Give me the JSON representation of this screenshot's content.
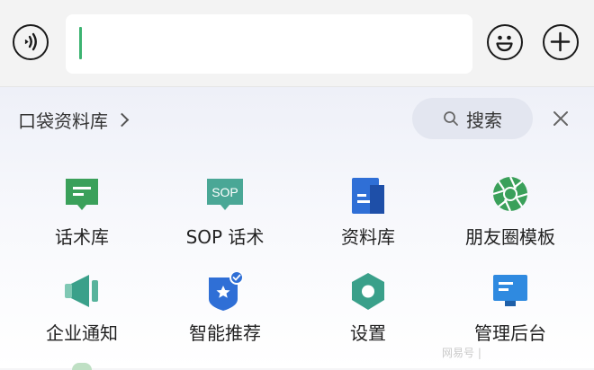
{
  "input_bar": {
    "text_value": ""
  },
  "panel": {
    "library_title": "口袋资料库",
    "search_label": "搜索"
  },
  "grid": [
    {
      "label": "话术库",
      "icon": "chat-bubble-green-icon"
    },
    {
      "label": "SOP 话术",
      "icon": "sop-bubble-icon",
      "badge_text": "SOP"
    },
    {
      "label": "资料库",
      "icon": "document-blue-icon"
    },
    {
      "label": "朋友圈模板",
      "icon": "camera-aperture-green-icon"
    },
    {
      "label": "企业通知",
      "icon": "megaphone-icon"
    },
    {
      "label": "智能推荐",
      "icon": "star-badge-check-icon"
    },
    {
      "label": "设置",
      "icon": "hexagon-settings-icon"
    },
    {
      "label": "管理后台",
      "icon": "monitor-blue-icon"
    }
  ],
  "watermark": "网易号 |",
  "colors": {
    "caret": "#3cb371",
    "green_icon": "#3aa05a",
    "blue_icon": "#2f6fd6",
    "teal_icon": "#4aa796"
  }
}
